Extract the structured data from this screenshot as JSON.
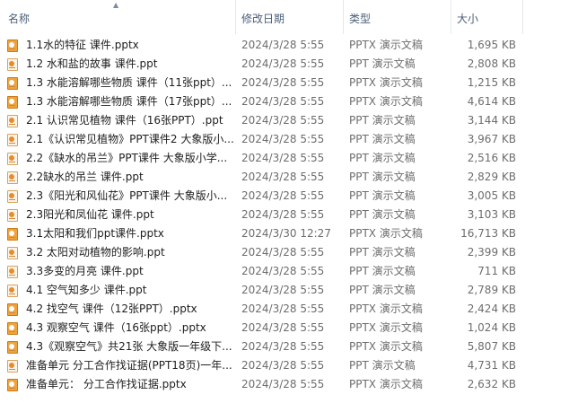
{
  "columns": {
    "name": "名称",
    "date": "修改日期",
    "type": "类型",
    "size": "大小"
  },
  "files": [
    {
      "name": "1.1水的特征 课件.pptx",
      "date": "2024/3/28 5:55",
      "type": "PPTX 演示文稿",
      "size": "1,695 KB",
      "icon": "pptx-icon"
    },
    {
      "name": "1.2 水和盐的故事 课件.ppt",
      "date": "2024/3/28 5:55",
      "type": "PPT 演示文稿",
      "size": "2,808 KB",
      "icon": "ppt-icon"
    },
    {
      "name": "1.3 水能溶解哪些物质 课件（11张ppt）...",
      "date": "2024/3/28 5:55",
      "type": "PPTX 演示文稿",
      "size": "1,215 KB",
      "icon": "pptx-icon"
    },
    {
      "name": "1.3 水能溶解哪些物质 课件（17张ppt）...",
      "date": "2024/3/28 5:55",
      "type": "PPTX 演示文稿",
      "size": "4,614 KB",
      "icon": "pptx-icon"
    },
    {
      "name": "2.1 认识常见植物 课件（16张PPT）.ppt",
      "date": "2024/3/28 5:55",
      "type": "PPT 演示文稿",
      "size": "3,144 KB",
      "icon": "ppt-icon"
    },
    {
      "name": "2.1《认识常见植物》PPT课件2 大象版小...",
      "date": "2024/3/28 5:55",
      "type": "PPT 演示文稿",
      "size": "3,967 KB",
      "icon": "ppt-icon"
    },
    {
      "name": "2.2《缺水的吊兰》PPT课件 大象版小学...",
      "date": "2024/3/28 5:55",
      "type": "PPT 演示文稿",
      "size": "2,516 KB",
      "icon": "ppt-icon"
    },
    {
      "name": "2.2缺水的吊兰 课件.ppt",
      "date": "2024/3/28 5:55",
      "type": "PPT 演示文稿",
      "size": "2,829 KB",
      "icon": "ppt-icon"
    },
    {
      "name": "2.3《阳光和风仙花》PPT课件 大象版小...",
      "date": "2024/3/28 5:55",
      "type": "PPT 演示文稿",
      "size": "3,005 KB",
      "icon": "ppt-icon"
    },
    {
      "name": "2.3阳光和凤仙花 课件.ppt",
      "date": "2024/3/28 5:55",
      "type": "PPT 演示文稿",
      "size": "3,103 KB",
      "icon": "ppt-icon"
    },
    {
      "name": "3.1太阳和我们ppt课件.pptx",
      "date": "2024/3/30 12:27",
      "type": "PPTX 演示文稿",
      "size": "16,713 KB",
      "icon": "pptx-icon"
    },
    {
      "name": "3.2 太阳对动植物的影响.ppt",
      "date": "2024/3/28 5:55",
      "type": "PPT 演示文稿",
      "size": "2,399 KB",
      "icon": "ppt-icon"
    },
    {
      "name": "3.3多变的月亮 课件.ppt",
      "date": "2024/3/28 5:55",
      "type": "PPT 演示文稿",
      "size": "711 KB",
      "icon": "ppt-icon"
    },
    {
      "name": "4.1 空气知多少 课件.ppt",
      "date": "2024/3/28 5:55",
      "type": "PPT 演示文稿",
      "size": "2,789 KB",
      "icon": "ppt-icon"
    },
    {
      "name": "4.2 找空气 课件（12张PPT）.pptx",
      "date": "2024/3/28 5:55",
      "type": "PPTX 演示文稿",
      "size": "2,424 KB",
      "icon": "pptx-icon"
    },
    {
      "name": "4.3 观察空气 课件（16张ppt）.pptx",
      "date": "2024/3/28 5:55",
      "type": "PPTX 演示文稿",
      "size": "1,024 KB",
      "icon": "pptx-icon"
    },
    {
      "name": "4.3《观察空气》共21张 大象版一年级下...",
      "date": "2024/3/28 5:55",
      "type": "PPTX 演示文稿",
      "size": "5,807 KB",
      "icon": "pptx-icon"
    },
    {
      "name": "准备单元 分工合作找证据(PPT18页)一年...",
      "date": "2024/3/28 5:55",
      "type": "PPT 演示文稿",
      "size": "4,731 KB",
      "icon": "ppt-icon"
    },
    {
      "name": "准备单元： 分工合作找证据.pptx",
      "date": "2024/3/28 5:55",
      "type": "PPTX 演示文稿",
      "size": "2,632 KB",
      "icon": "pptx-icon"
    }
  ]
}
